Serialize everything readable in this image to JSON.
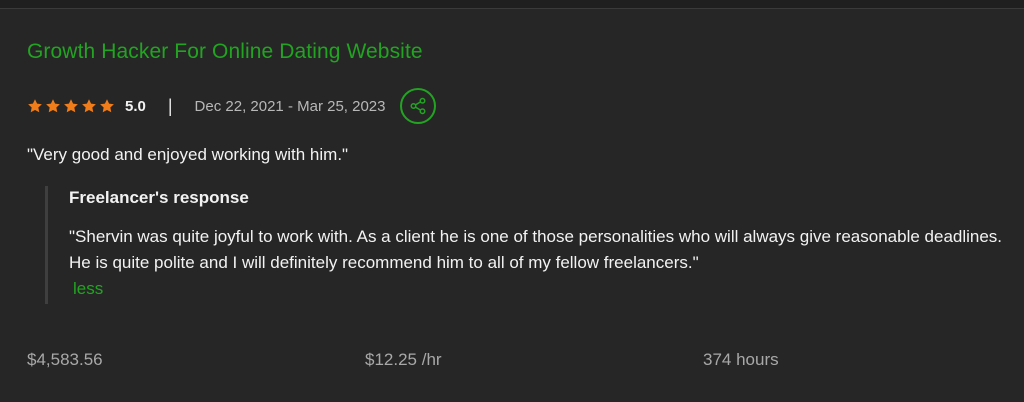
{
  "job": {
    "title": "Growth Hacker For Online Dating Website",
    "rating_value": "5.0",
    "rating_stars": 5,
    "divider": "|",
    "date_range": "Dec 22, 2021 - Mar 25, 2023",
    "share_icon": "share-icon",
    "review": "\"Very good and enjoyed working with him.\""
  },
  "response": {
    "heading": "Freelancer's response",
    "text": "\"Shervin was quite joyful to work with. As a client he is one of those personalities who will always give reasonable deadlines. He is quite polite and I will definitely recommend him to all of my fellow freelancers.\"",
    "less_label": "less"
  },
  "stats": {
    "earnings": "$4,583.56",
    "rate": "$12.25 /hr",
    "hours": "374 hours"
  },
  "colors": {
    "background": "#262626",
    "accent_green": "#22a422",
    "star_orange": "#f07d1a",
    "text_primary": "#f2f2f2",
    "text_muted": "#a8a8a8"
  }
}
